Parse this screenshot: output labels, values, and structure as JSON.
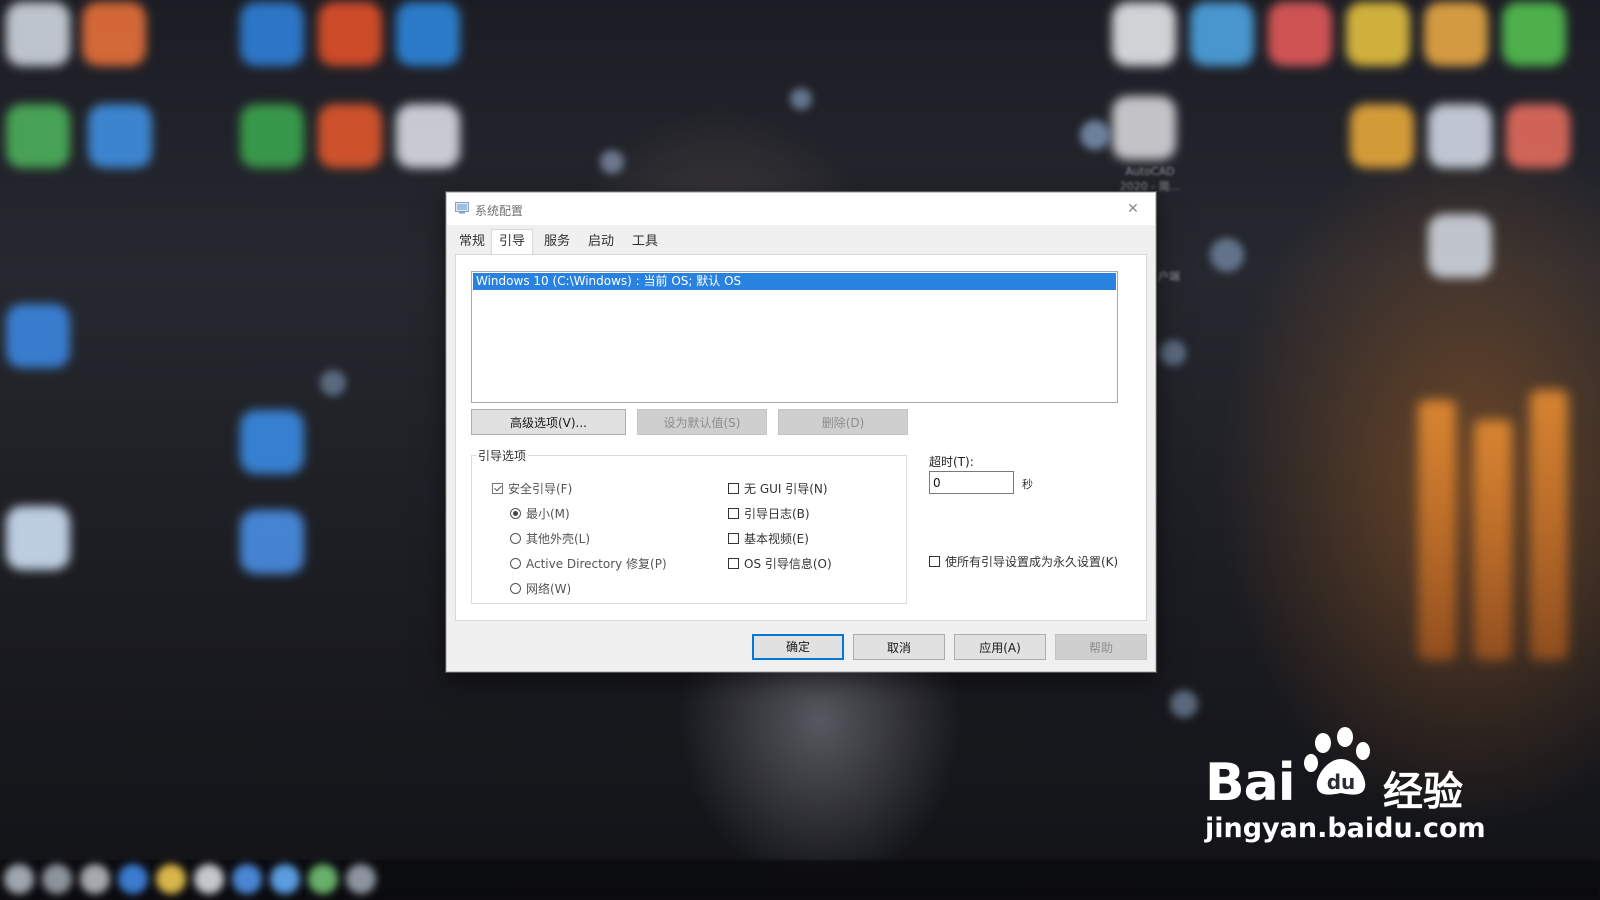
{
  "window": {
    "title": "系统配置",
    "tabs": [
      {
        "label": "常规",
        "active": false
      },
      {
        "label": "引导",
        "active": true
      },
      {
        "label": "服务",
        "active": false
      },
      {
        "label": "启动",
        "active": false
      },
      {
        "label": "工具",
        "active": false
      }
    ]
  },
  "boot": {
    "os_entries": [
      "Windows 10 (C:\\Windows) : 当前 OS; 默认 OS"
    ],
    "buttons": {
      "advanced": "高级选项(V)...",
      "set_default": "设为默认值(S)",
      "delete": "删除(D)"
    },
    "options_group": {
      "legend": "引导选项",
      "safe_boot": {
        "label": "安全引导(F)",
        "checked": true
      },
      "minimal": {
        "label": "最小(M)",
        "selected": true
      },
      "alternate_shell": {
        "label": "其他外壳(L)",
        "selected": false
      },
      "ad_repair": {
        "label": "Active Directory 修复(P)",
        "selected": false
      },
      "network": {
        "label": "网络(W)",
        "selected": false
      },
      "no_gui": {
        "label": "无 GUI 引导(N)",
        "checked": false
      },
      "boot_log": {
        "label": "引导日志(B)",
        "checked": false
      },
      "base_video": {
        "label": "基本视频(E)",
        "checked": false
      },
      "os_boot_info": {
        "label": "OS 引导信息(O)",
        "checked": false
      }
    },
    "timeout": {
      "label": "超时(T):",
      "value": "0",
      "unit": "秒"
    },
    "permanent": {
      "label": "使所有引导设置成为永久设置(K)",
      "checked": false
    }
  },
  "footer": {
    "ok": "确定",
    "cancel": "取消",
    "apply": "应用(A)",
    "help": "帮助"
  },
  "desktop": {
    "icon_label_1": "AutoCAD 2020 - 简...",
    "icon_label_2": "户端"
  },
  "watermark": {
    "brand": "Bai",
    "brand_suffix": "经验",
    "url": "jingyan.baidu.com"
  },
  "colors": {
    "selection": "#2a82e0",
    "default_button_border": "#0078d7",
    "dialog_bg": "#f0f0f0"
  }
}
